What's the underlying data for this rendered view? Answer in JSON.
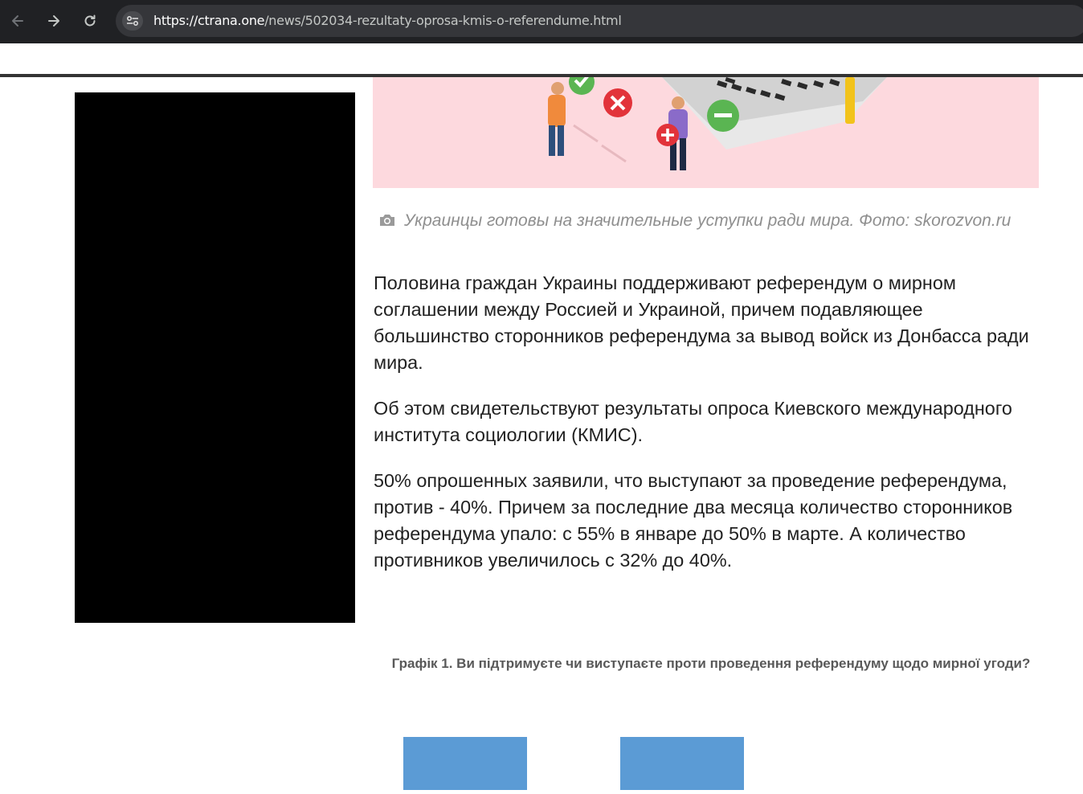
{
  "browser": {
    "url_host": "https://ctrana.one",
    "url_path": "/news/502034-rezultaty-oprosa-kmis-o-referendume.html"
  },
  "article": {
    "photo_caption": "Украинцы готовы на значительные уступки ради мира. Фото: skorozvon.ru",
    "paragraphs": [
      "Половина граждан Украины поддерживают референдум о мирном соглашении между Россией и Украиной, причем подавляющее большинство сторонников референдума за вывод войск из Донбасса ради мира.",
      "Об этом свидетельствуют результаты опроса Киевского международного института социологии (КМИС).",
      "50% опрошенных заявили, что выступают за проведение референдума, против - 40%. Причем за последние два месяца количество сторонников референдума упало: с 55% в январе до 50% в марте. А количество противников увеличилось с 32% до 40%."
    ]
  },
  "chart_data": {
    "type": "bar",
    "title": "Графік 1. Ви підтримуєте чи виступаєте проти проведення референдуму щодо мирної угоди?",
    "bar_color": "#5b9bd5",
    "visible_bar_count": 2,
    "note": ""
  },
  "colors": {
    "chrome_bg": "#202124",
    "image_bg": "#fdd9de",
    "bar": "#5b9bd5"
  }
}
